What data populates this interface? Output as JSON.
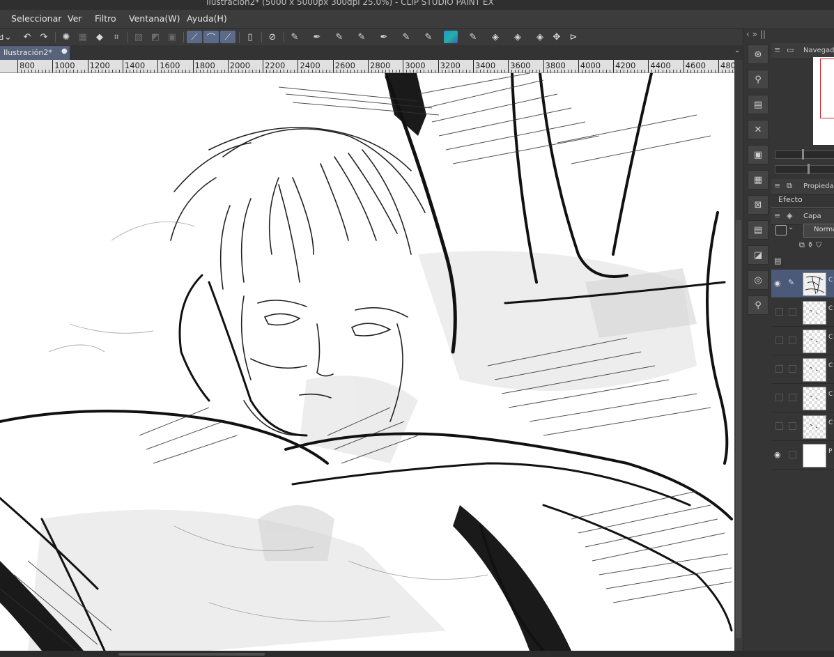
{
  "titlebar": {
    "title": "Ilustración2* (5000 x 5000px 300dpi 25.0%)  - CLIP STUDIO PAINT EX"
  },
  "menubar": {
    "items": [
      "Seleccionar",
      "Ver",
      "Filtro",
      "Ventana(W)",
      "Ayuda(H)"
    ]
  },
  "toolbar": {
    "tools": [
      "layer-icon",
      "undo-icon",
      "redo-icon",
      "selection-loading-icon",
      "selection-grid-icon",
      "fill-icon",
      "crop-icon",
      "snap-off-icon",
      "snap-ruler-icon",
      "snap-grid-icon",
      "ruler-line-icon",
      "ruler-curve-icon",
      "ruler-ellipse-icon",
      "device-icon",
      "shortcut-icon",
      "pen-icon",
      "pen2-icon",
      "marker-icon",
      "pencil-icon",
      "brush-icon",
      "brush2-icon",
      "brush3-icon",
      "color-swatch-icon",
      "pen3-icon",
      "eraser-icon",
      "eraser2-icon",
      "eraser3-icon",
      "move-icon",
      "flip-icon"
    ]
  },
  "tab": {
    "label": "Ilustración2*",
    "modified_mark": "●"
  },
  "ruler": {
    "labels": [
      "800",
      "1000",
      "1200",
      "1400",
      "1600",
      "1800",
      "2000",
      "2200",
      "2400",
      "2600",
      "2800",
      "3000",
      "3200",
      "3400",
      "3600",
      "3800",
      "4000",
      "4200",
      "4400",
      "4600",
      "480"
    ]
  },
  "right_column": {
    "arrows": "‹  »  ||",
    "buttons": [
      "navigator-icon",
      "subview-icon",
      "tool-property-icon",
      "brush-size-icon",
      "layer-property-icon",
      "history-icon",
      "color-wheel-icon",
      "layer-search-icon",
      "layer-comp-icon",
      "material-icon",
      "animation-icon"
    ]
  },
  "panels": {
    "navigator": {
      "label": "Navegador"
    },
    "properties": {
      "label": "Propiedad"
    },
    "effect": {
      "label": "Efecto"
    },
    "layer": {
      "label": "Capa",
      "blend_mode": "Norma"
    }
  },
  "layers": [
    {
      "visible": true,
      "selected": true,
      "editing": true,
      "thumb": "drawn",
      "side": "C"
    },
    {
      "visible": false,
      "selected": false,
      "editing": false,
      "thumb": "transparent",
      "side": "C"
    },
    {
      "visible": false,
      "selected": false,
      "editing": false,
      "thumb": "transparent",
      "side": "C"
    },
    {
      "visible": false,
      "selected": false,
      "editing": false,
      "thumb": "transparent",
      "side": "C"
    },
    {
      "visible": false,
      "selected": false,
      "editing": false,
      "thumb": "transparent",
      "side": "C"
    },
    {
      "visible": false,
      "selected": false,
      "editing": false,
      "thumb": "transparent",
      "side": "C"
    },
    {
      "visible": true,
      "selected": false,
      "editing": false,
      "thumb": "white",
      "side": "P"
    }
  ]
}
